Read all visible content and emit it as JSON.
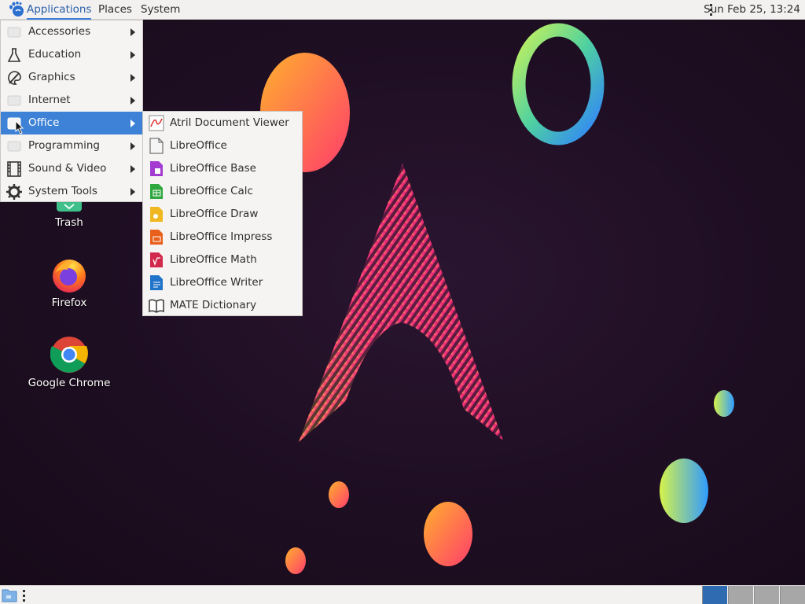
{
  "top_panel": {
    "applications_label": "Applications",
    "places_label": "Places",
    "system_label": "System",
    "clock": "Sun Feb 25, 13:24"
  },
  "desktop_icons": [
    {
      "label": "Trash",
      "icon": "trash-icon"
    },
    {
      "label": "Firefox",
      "icon": "firefox-icon"
    },
    {
      "label": "Google Chrome",
      "icon": "chrome-icon"
    }
  ],
  "applications_menu": {
    "items": [
      {
        "label": "Accessories",
        "icon": "accessories-icon"
      },
      {
        "label": "Education",
        "icon": "flask-icon"
      },
      {
        "label": "Graphics",
        "icon": "palette-icon"
      },
      {
        "label": "Internet",
        "icon": "internet-icon"
      },
      {
        "label": "Office",
        "icon": "office-icon",
        "active": true
      },
      {
        "label": "Programming",
        "icon": "programming-icon"
      },
      {
        "label": "Sound & Video",
        "icon": "film-icon"
      },
      {
        "label": "System Tools",
        "icon": "gear-icon"
      }
    ]
  },
  "office_menu": {
    "items": [
      {
        "label": "Atril Document Viewer",
        "icon": "document-viewer-icon"
      },
      {
        "label": "LibreOffice",
        "icon": "libreoffice-icon"
      },
      {
        "label": "LibreOffice Base",
        "icon": "libreoffice-base-icon"
      },
      {
        "label": "LibreOffice Calc",
        "icon": "libreoffice-calc-icon"
      },
      {
        "label": "LibreOffice Draw",
        "icon": "libreoffice-draw-icon"
      },
      {
        "label": "LibreOffice Impress",
        "icon": "libreoffice-impress-icon"
      },
      {
        "label": "LibreOffice Math",
        "icon": "libreoffice-math-icon"
      },
      {
        "label": "LibreOffice Writer",
        "icon": "libreoffice-writer-icon"
      },
      {
        "label": "MATE Dictionary",
        "icon": "dictionary-icon"
      }
    ]
  },
  "bottom_panel": {
    "workspaces": 4,
    "active_workspace": 1
  }
}
